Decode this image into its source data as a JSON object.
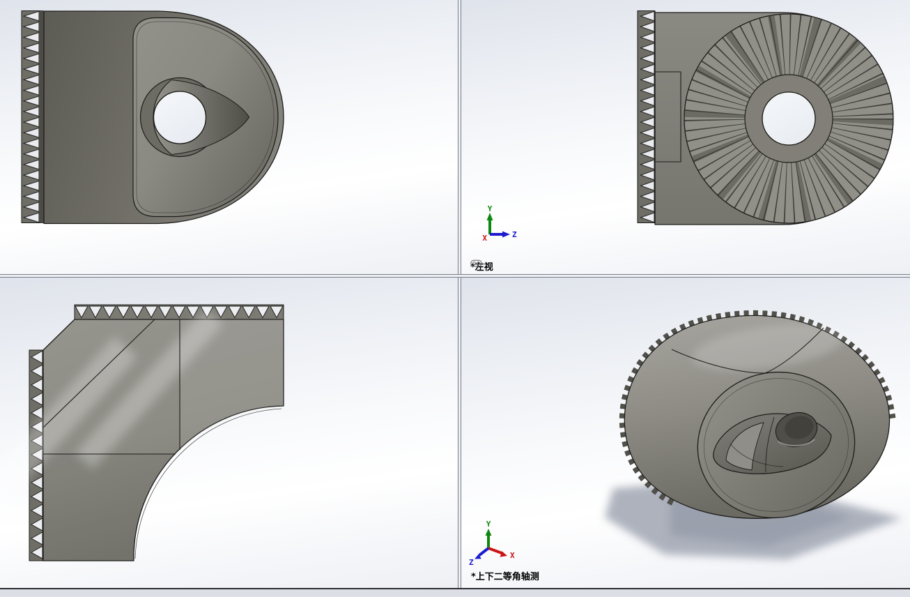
{
  "viewports": {
    "top_left": {
      "label": ""
    },
    "top_right": {
      "label": "*左视",
      "linked_icon": "chain-link"
    },
    "bottom_left": {
      "label": ""
    },
    "bottom_right": {
      "label": "*上下二等角轴测"
    }
  },
  "axis_triad": {
    "x": "X",
    "y": "Y",
    "z": "Z"
  },
  "colors": {
    "axis_x": "#cc1414",
    "axis_y": "#0e870e",
    "axis_z": "#1c1ccd",
    "edge": "#1d1d1b",
    "part_base": "#82817a",
    "part_dark": "#55544d",
    "part_light": "#9a9992",
    "hole_fill": "#f2f5f8",
    "bg_top": "#dfe3eb",
    "bg_bottom": "#eef0f4",
    "divider_line": "#767b88",
    "statusbar": "#dce0e6",
    "shadow": "#9aa0ad"
  }
}
